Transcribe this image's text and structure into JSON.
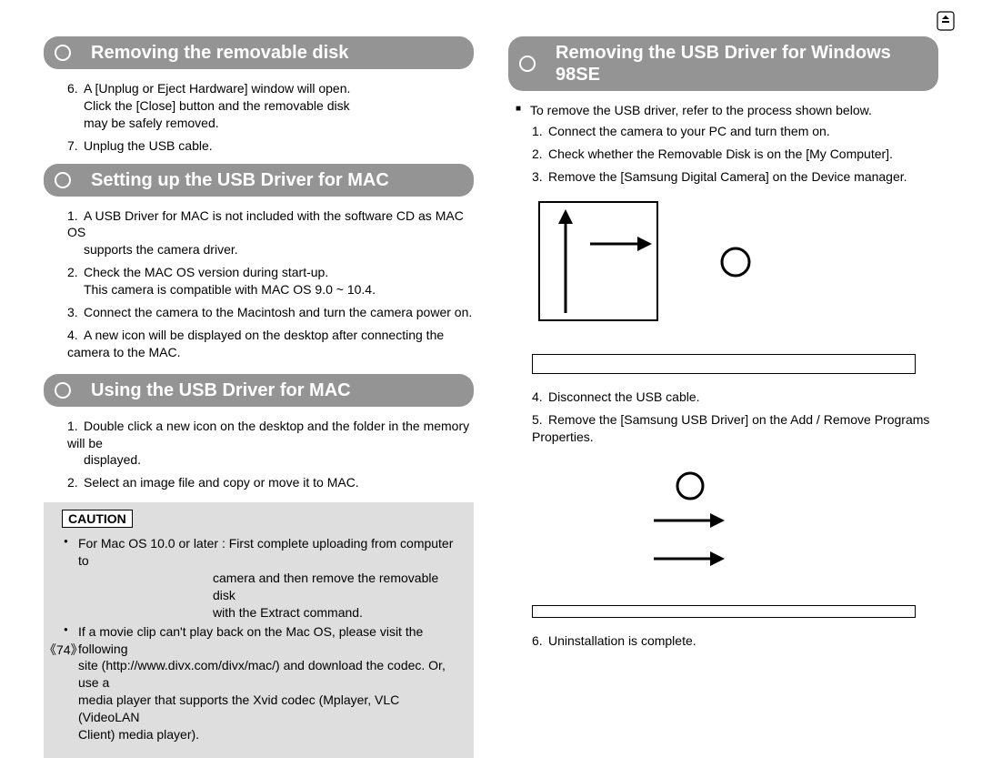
{
  "page_number": "74",
  "left": {
    "section1": {
      "title": "Removing the removable disk",
      "step6": {
        "num": "6.",
        "l1": "A [Unplug or Eject Hardware] window will open.",
        "l2": "Click the [Close] button and the removable disk",
        "l3": "may be safely removed."
      },
      "step7": {
        "num": "7.",
        "l1": "Unplug the USB cable."
      }
    },
    "section2": {
      "title": "Setting up the USB Driver for MAC",
      "step1": {
        "num": "1.",
        "l1": "A USB Driver for MAC is not included with the software CD as MAC OS",
        "l2": "supports the camera driver."
      },
      "step2": {
        "num": "2.",
        "l1": "Check the MAC OS version during start-up.",
        "l2": "This camera is compatible with MAC OS 9.0 ~ 10.4."
      },
      "step3": {
        "num": "3.",
        "l1": "Connect the camera to the Macintosh and turn the camera power on."
      },
      "step4": {
        "num": "4.",
        "l1": "A new icon will be displayed on the desktop after connecting the camera to the MAC."
      }
    },
    "section3": {
      "title": "Using the USB Driver for MAC",
      "step1": {
        "num": "1.",
        "l1": "Double click a new icon on the desktop and the folder in the memory will be",
        "l2": "displayed."
      },
      "step2": {
        "num": "2.",
        "l1": "Select an image file and copy or move it to MAC."
      }
    },
    "caution": {
      "label": "CAUTION",
      "b1": {
        "l1": "For Mac OS 10.0 or later : First complete uploading from computer to",
        "l2": "camera and then remove the removable disk",
        "l3": "with the Extract command."
      },
      "b2": {
        "l1": "If a movie clip can't play back on the Mac OS, please visit the following",
        "l2": "site (http://www.divx.com/divx/mac/) and download the codec. Or, use a",
        "l3": "media player that supports the Xvid codec (Mplayer, VLC (VideoLAN",
        "l4": "Client) media player)."
      }
    }
  },
  "right": {
    "section1": {
      "title": "Removing the USB Driver for Windows 98SE",
      "intro": "To remove the USB driver, refer to the process shown below.",
      "step1": {
        "num": "1.",
        "l1": "Connect the camera to your PC and turn them on."
      },
      "step2": {
        "num": "2.",
        "l1": "Check whether the Removable Disk is on the [My Computer]."
      },
      "step3": {
        "num": "3.",
        "l1": "Remove the [Samsung Digital Camera] on the Device manager."
      },
      "step4": {
        "num": "4.",
        "l1": "Disconnect the USB cable."
      },
      "step5": {
        "num": "5.",
        "l1": "Remove the [Samsung USB Driver] on the Add / Remove Programs Properties."
      },
      "step6": {
        "num": "6.",
        "l1": "Uninstallation is complete."
      }
    }
  }
}
